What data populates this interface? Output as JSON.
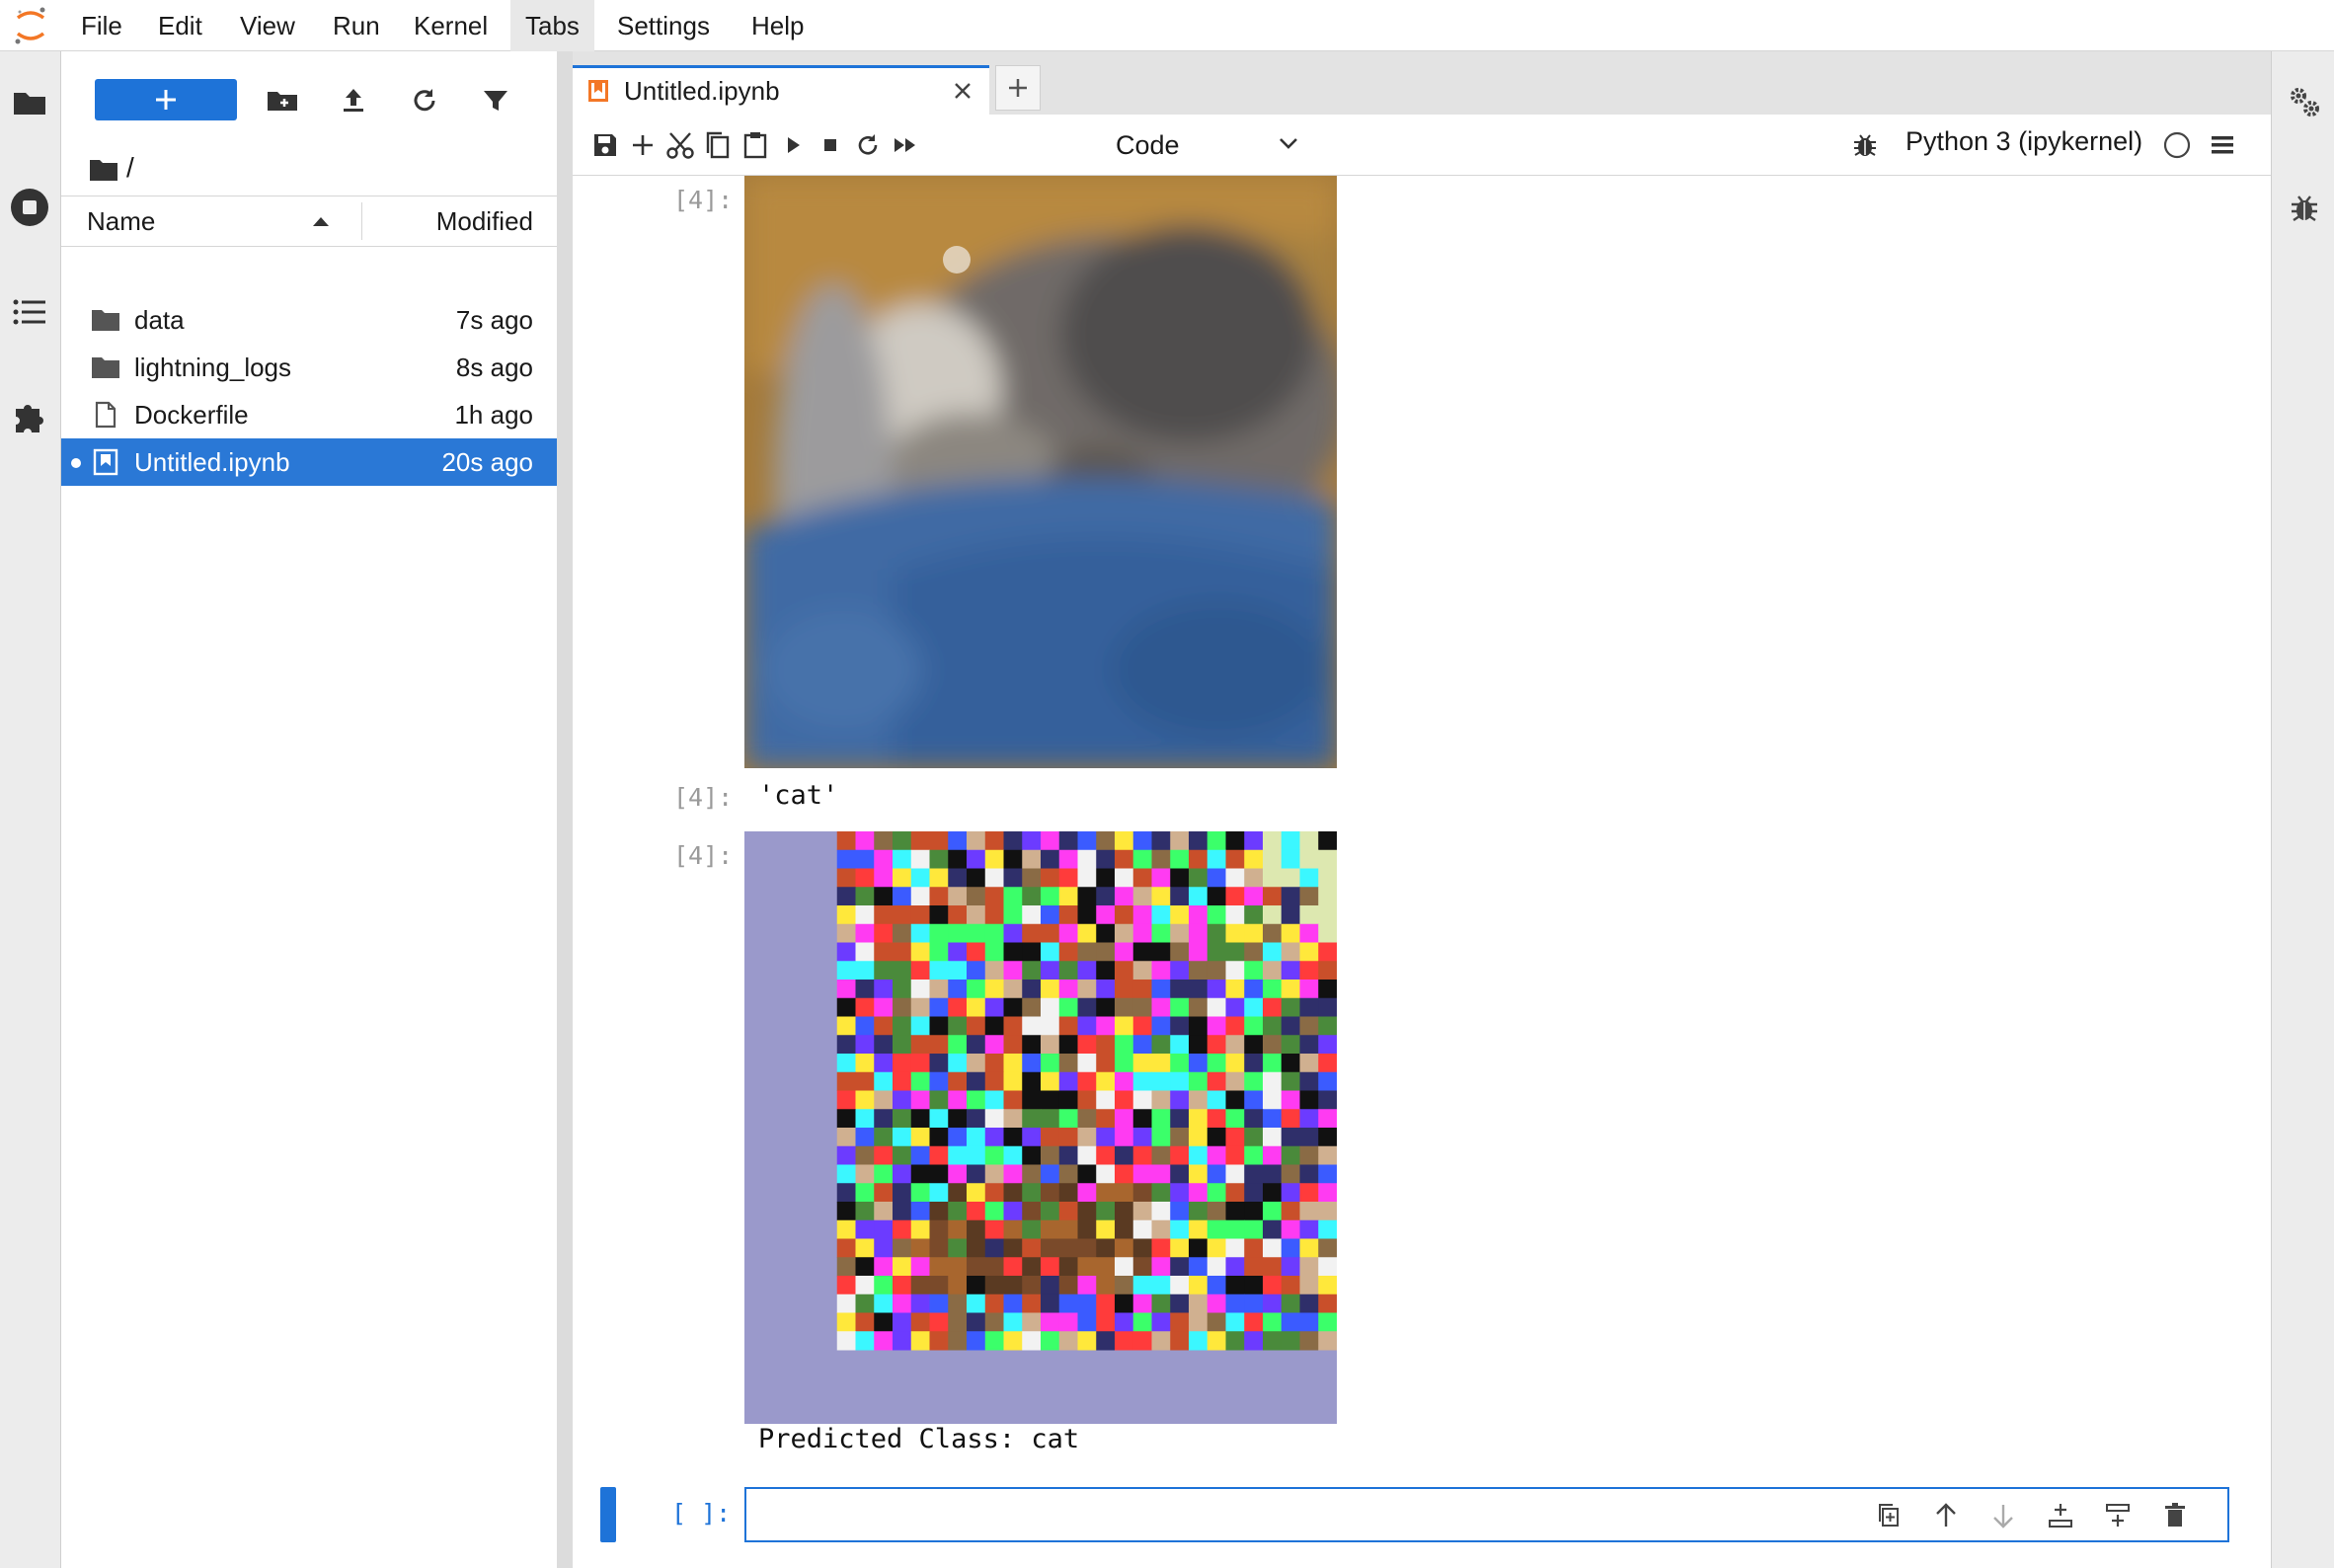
{
  "menubar": {
    "items": [
      "File",
      "Edit",
      "View",
      "Run",
      "Kernel",
      "Tabs",
      "Settings",
      "Help"
    ],
    "active_item": "Tabs"
  },
  "colors": {
    "accent": "#1e73d8",
    "jupyter_orange": "#f37726",
    "selection": "#2a78d6"
  },
  "filebrowser": {
    "new_button_label": "+",
    "breadcrumb": "/",
    "columns": {
      "name": "Name",
      "modified": "Modified"
    },
    "sort": "name-ascending",
    "rows": [
      {
        "name": "data",
        "modified": "7s ago",
        "icon": "folder-icon"
      },
      {
        "name": "lightning_logs",
        "modified": "8s ago",
        "icon": "folder-icon"
      },
      {
        "name": "Dockerfile",
        "modified": "1h ago",
        "icon": "file-icon"
      },
      {
        "name": "Untitled.ipynb",
        "modified": "20s ago",
        "icon": "notebook-icon",
        "selected": true,
        "running": true
      }
    ]
  },
  "tabs": {
    "documents": [
      {
        "label": "Untitled.ipynb",
        "icon": "notebook-icon",
        "active": true
      }
    ],
    "add_label": "+"
  },
  "notebook_toolbar": {
    "cell_type": "Code",
    "kernel_name": "Python 3 (ipykernel)",
    "kernel_status": "idle"
  },
  "cells": {
    "out1_prompt": "[4]:",
    "out2_prompt": "[4]:",
    "out2_text": "'cat'",
    "out3_prompt": "[4]:",
    "out3_text": "Predicted Class: cat",
    "input_prompt": "[ ]:",
    "input_value": ""
  }
}
